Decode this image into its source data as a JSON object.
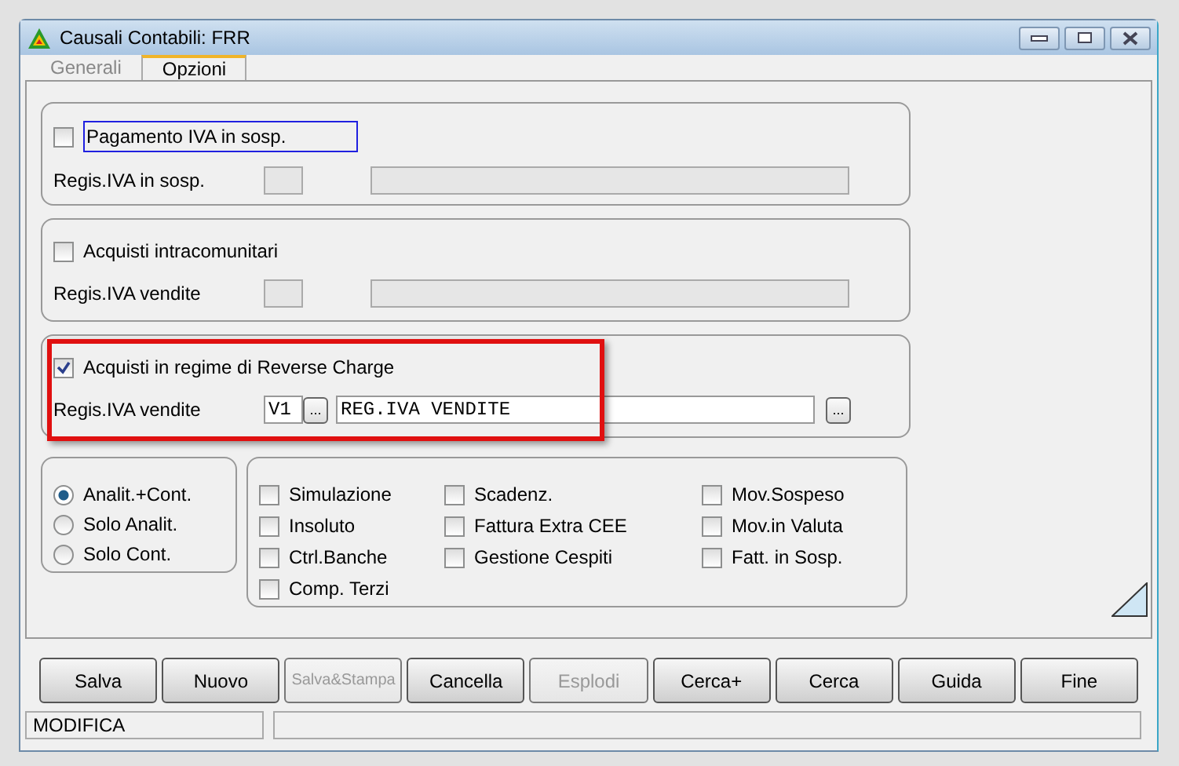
{
  "window": {
    "title": "Causali Contabili: FRR"
  },
  "tabs": [
    {
      "label": "Generali",
      "selected": false
    },
    {
      "label": "Opzioni",
      "selected": true
    }
  ],
  "groups": [
    {
      "checkbox": {
        "label": "Pagamento IVA in sosp.",
        "checked": false,
        "focused": true
      },
      "field_label": "Regis.IVA in sosp.",
      "code": {
        "enabled": false
      },
      "description": {
        "enabled": false
      },
      "highlighted": false
    },
    {
      "checkbox": {
        "label": "Acquisti intracomunitari",
        "checked": false,
        "focused": false
      },
      "field_label": "Regis.IVA vendite",
      "code": {
        "enabled": false
      },
      "description": {
        "enabled": false
      },
      "highlighted": false
    },
    {
      "checkbox": {
        "label": "Acquisti in regime di Reverse Charge",
        "checked": true,
        "focused": false
      },
      "field_label": "Regis.IVA vendite",
      "code": {
        "enabled": true,
        "value": "V1",
        "browse": "..."
      },
      "description": {
        "enabled": true,
        "value": "REG.IVA VENDITE",
        "browse": "..."
      },
      "highlighted": true
    }
  ],
  "modes": [
    {
      "label": "Analit.+Cont.",
      "selected": true
    },
    {
      "label": "Solo Analit.",
      "selected": false
    },
    {
      "label": "Solo Cont.",
      "selected": false
    }
  ],
  "options": [
    [
      {
        "label": "Simulazione",
        "checked": false
      },
      {
        "label": "Insoluto",
        "checked": false
      },
      {
        "label": "Ctrl.Banche",
        "checked": false
      },
      {
        "label": "Comp. Terzi",
        "checked": false
      }
    ],
    [
      {
        "label": "Scadenz.",
        "checked": false
      },
      {
        "label": "Fattura Extra CEE",
        "checked": false
      },
      {
        "label": "Gestione Cespiti",
        "checked": false
      }
    ],
    [
      {
        "label": "Mov.Sospeso",
        "checked": false
      },
      {
        "label": "Mov.in Valuta",
        "checked": false
      },
      {
        "label": "Fatt. in Sosp.",
        "checked": false
      }
    ]
  ],
  "buttons": [
    {
      "label": "Salva",
      "disabled": false
    },
    {
      "label": "Nuovo",
      "disabled": false
    },
    {
      "label": "Salva&Stampa",
      "disabled": true
    },
    {
      "label": "Cancella",
      "disabled": false
    },
    {
      "label": "Esplodi",
      "disabled": true
    },
    {
      "label": "Cerca+",
      "disabled": false
    },
    {
      "label": "Cerca",
      "disabled": false
    },
    {
      "label": "Guida",
      "disabled": false
    },
    {
      "label": "Fine",
      "disabled": false
    }
  ],
  "status_bar": {
    "mode": "MODIFICA"
  }
}
